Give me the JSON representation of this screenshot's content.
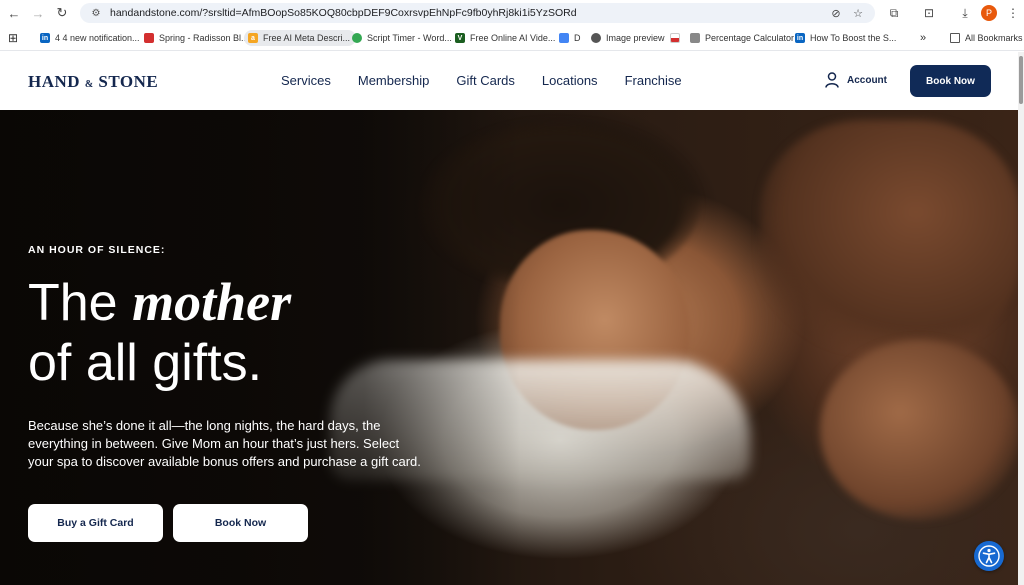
{
  "browser": {
    "url": "handandstone.com/?srsltid=AfmBOopSo85KOQ80cbpDEF9CoxrsvpEhNpFc9fb0yhRj8ki1i5YzSORd",
    "profile_initial": "P",
    "bookmarks": [
      {
        "label": "4 4 new notification...",
        "color": "#0a66c2",
        "fav": "in"
      },
      {
        "label": "Spring - Radisson Bl...",
        "color": "#d32f2f",
        "fav": ""
      },
      {
        "label": "Free AI Meta Descri...",
        "color": "#f5a623",
        "fav": "a"
      },
      {
        "label": "Script Timer - Word...",
        "color": "#34a853",
        "fav": ""
      },
      {
        "label": "Free Online AI Vide...",
        "color": "#1b5e20",
        "fav": "V"
      },
      {
        "label": "D",
        "color": "#4285f4",
        "fav": ""
      },
      {
        "label": "Image preview",
        "color": "#555555",
        "fav": ""
      },
      {
        "label": "",
        "color": "#d32f2f",
        "fav": ""
      },
      {
        "label": "Percentage Calculator",
        "color": "#888888",
        "fav": ""
      },
      {
        "label": "How To Boost the S...",
        "color": "#0a66c2",
        "fav": "in"
      }
    ],
    "more_bookmarks": "»",
    "all_bookmarks": "All Bookmarks"
  },
  "header": {
    "logo_hand": "HAND",
    "logo_amp": "&",
    "logo_stone": "STONE",
    "nav": [
      "Services",
      "Membership",
      "Gift Cards",
      "Locations",
      "Franchise"
    ],
    "account_label": "Account",
    "book_now_label": "Book Now"
  },
  "hero": {
    "eyebrow": "AN HOUR OF SILENCE:",
    "headline_pre": "The ",
    "headline_em": "mother",
    "headline_line2": "of all gifts.",
    "description": "Because she’s done it all—the long nights, the hard days, the everything in between. Give Mom an hour that’s just hers. Select your spa to discover available bonus offers and purchase a gift card.",
    "btn_gift": "Buy a Gift Card",
    "btn_book": "Book Now"
  },
  "colors": {
    "navy": "#14274e",
    "button_navy": "#102a57",
    "accessibility_blue": "#1769d1"
  }
}
